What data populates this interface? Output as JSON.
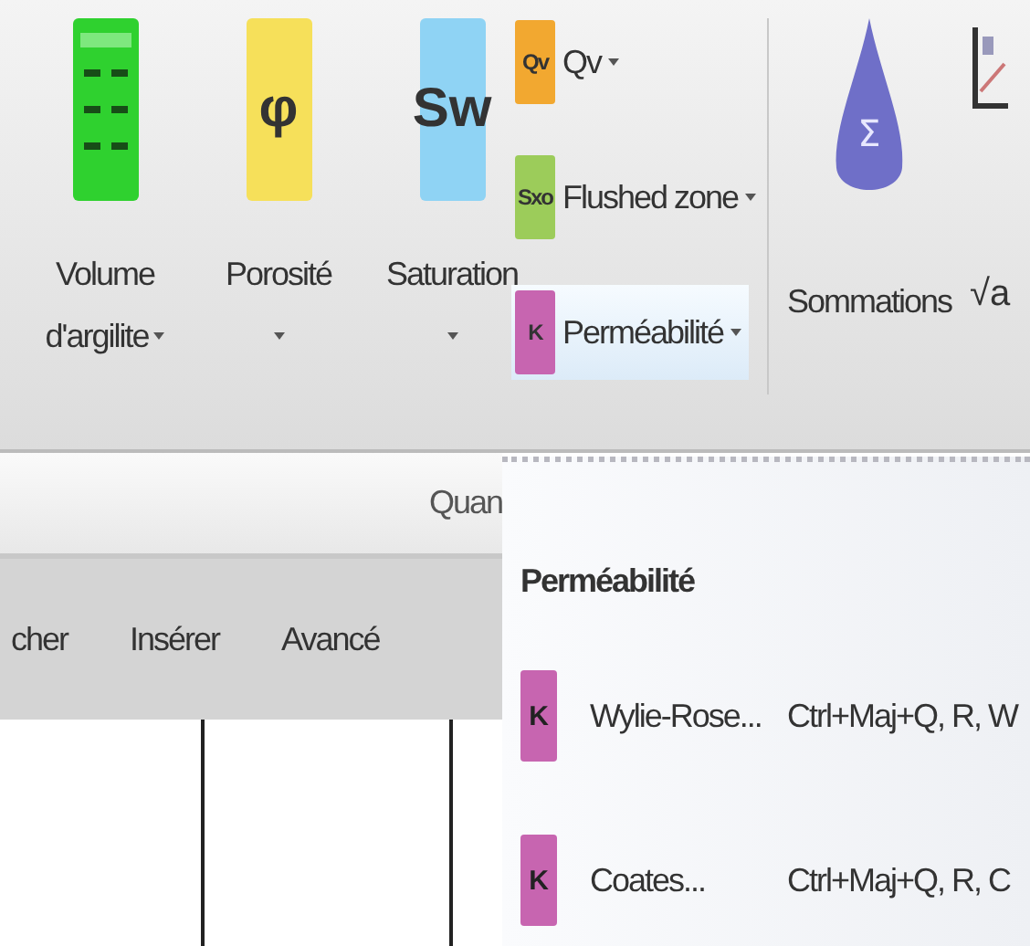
{
  "ribbon": {
    "large_buttons": [
      {
        "kind": "clay",
        "label": "Volume",
        "label_line2": "d'argilite",
        "has_menu": true
      },
      {
        "kind": "badge",
        "icon_text": "φ",
        "color": "#f6e05a",
        "label": "Porosité",
        "has_menu": true
      },
      {
        "kind": "badge",
        "icon_text": "Sw",
        "color": "#8fd3f4",
        "label": "Saturation",
        "has_menu": true
      }
    ],
    "small_buttons": [
      {
        "icon_text": "Qv",
        "color": "#f2a830",
        "label": "Qv",
        "has_menu": true,
        "open": false
      },
      {
        "icon_text": "Sxo",
        "color": "#9ccc5a",
        "label": "Flushed zone",
        "has_menu": true,
        "open": false
      },
      {
        "icon_text": "K",
        "color": "#c765b0",
        "label": "Perméabilité",
        "has_menu": true,
        "open": true
      }
    ],
    "sum_button": {
      "icon_text": "Σ",
      "label": "Sommations"
    },
    "sqrt_button": {
      "label": "√a"
    },
    "group_label": "Quan"
  },
  "tabs": [
    {
      "label": "cher",
      "selected": false
    },
    {
      "label": "Insérer",
      "selected": false
    },
    {
      "label": "Avancé",
      "selected": false
    }
  ],
  "menu": {
    "header": "Perméabilité",
    "items": [
      {
        "icon_text": "K",
        "label": "Wylie-Rose...",
        "shortcut": "Ctrl+Maj+Q, R, W"
      },
      {
        "icon_text": "K",
        "label": "Coates...",
        "shortcut": "Ctrl+Maj+Q, R, C"
      }
    ]
  }
}
